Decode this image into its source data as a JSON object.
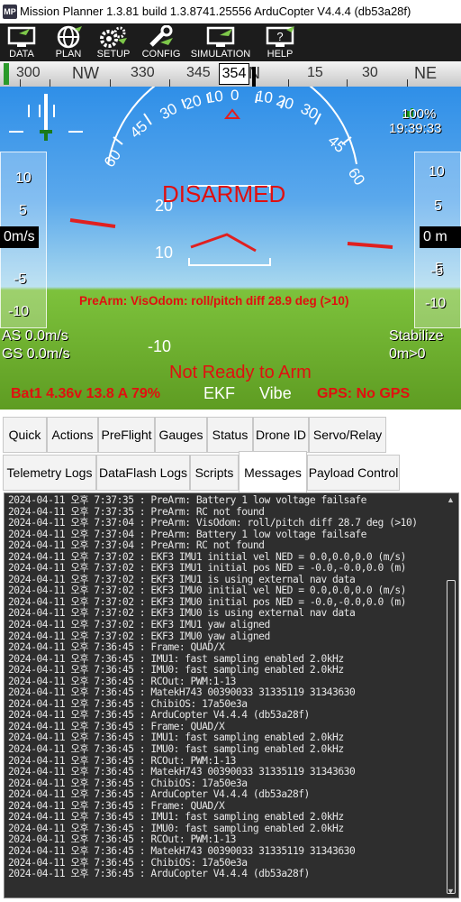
{
  "window": {
    "title": "Mission Planner 1.3.81 build 1.3.8741.25556 ArduCopter V4.4.4 (db53a28f)",
    "icon_text": "MP"
  },
  "toolbar": {
    "items": [
      {
        "label": "DATA",
        "icon": "monitor-plane-icon"
      },
      {
        "label": "PLAN",
        "icon": "globe-icon"
      },
      {
        "label": "SETUP",
        "icon": "gears-icon"
      },
      {
        "label": "CONFIG",
        "icon": "wrench-icon"
      },
      {
        "label": "SIMULATION",
        "icon": "monitor-icon"
      },
      {
        "label": "HELP",
        "icon": "help-monitor-icon"
      }
    ]
  },
  "compass": {
    "labels": [
      "300",
      "NW",
      "330",
      "345",
      "N",
      "15",
      "30",
      "NE"
    ],
    "heading": "354"
  },
  "hud": {
    "status": "DISARMED",
    "prearm_message": "PreArm: VisOdom: roll/pitch diff 28.9 deg (>10)",
    "airspeed": "AS 0.0m/s",
    "groundspeed": "GS 0.0m/s",
    "mode": "Stabilize",
    "wp_distance": "0m>0",
    "arm_status": "Not Ready to Arm",
    "battery": "Bat1 4.36v 13.8 A 79%",
    "ekf": "EKF",
    "vibe": "Vibe",
    "gps": "GPS: No GPS",
    "link_quality": "100%",
    "clock": "19:39:33",
    "speed_box": "0m/s",
    "alt_box": "0 m",
    "speed_ticks": [
      "10",
      "5",
      "-5",
      "-10"
    ],
    "alt_ticks": [
      "10",
      "5",
      "-5",
      "-10"
    ],
    "roll_labels": [
      "60",
      "45",
      "30",
      "20",
      "10",
      "0",
      "10",
      "20",
      "30",
      "45",
      "60"
    ],
    "pitch_labels": [
      "20",
      "10",
      "-10"
    ],
    "colors": {
      "sky_top": "#2f8fe8",
      "ground": "#5e9c22",
      "alert_red": "#e01010",
      "attitude_red": "#e02020"
    }
  },
  "tabs": {
    "row1": [
      "Quick",
      "Actions",
      "PreFlight",
      "Gauges",
      "Status",
      "Drone ID",
      "Servo/Relay"
    ],
    "row2": [
      "Telemetry Logs",
      "DataFlash Logs",
      "Scripts",
      "Messages",
      "Payload Control"
    ],
    "active": "Messages"
  },
  "messages": [
    "2024-04-11 오후 7:37:35 : PreArm: Battery 1 low voltage failsafe",
    "2024-04-11 오후 7:37:35 : PreArm: RC not found",
    "2024-04-11 오후 7:37:04 : PreArm: VisOdom: roll/pitch diff 28.7 deg (>10)",
    "2024-04-11 오후 7:37:04 : PreArm: Battery 1 low voltage failsafe",
    "2024-04-11 오후 7:37:04 : PreArm: RC not found",
    "2024-04-11 오후 7:37:02 : EKF3 IMU1 initial vel NED = 0.0,0.0,0.0 (m/s)",
    "2024-04-11 오후 7:37:02 : EKF3 IMU1 initial pos NED = -0.0,-0.0,0.0 (m)",
    "2024-04-11 오후 7:37:02 : EKF3 IMU1 is using external nav data",
    "2024-04-11 오후 7:37:02 : EKF3 IMU0 initial vel NED = 0.0,0.0,0.0 (m/s)",
    "2024-04-11 오후 7:37:02 : EKF3 IMU0 initial pos NED = -0.0,-0.0,0.0 (m)",
    "2024-04-11 오후 7:37:02 : EKF3 IMU0 is using external nav data",
    "2024-04-11 오후 7:37:02 : EKF3 IMU1 yaw aligned",
    "2024-04-11 오후 7:37:02 : EKF3 IMU0 yaw aligned",
    "2024-04-11 오후 7:36:45 : Frame: QUAD/X",
    "2024-04-11 오후 7:36:45 : IMU1: fast sampling enabled 2.0kHz",
    "2024-04-11 오후 7:36:45 : IMU0: fast sampling enabled 2.0kHz",
    "2024-04-11 오후 7:36:45 : RCOut: PWM:1-13",
    "2024-04-11 오후 7:36:45 : MatekH743 00390033 31335119 31343630",
    "2024-04-11 오후 7:36:45 : ChibiOS: 17a50e3a",
    "2024-04-11 오후 7:36:45 : ArduCopter V4.4.4 (db53a28f)",
    "2024-04-11 오후 7:36:45 : Frame: QUAD/X",
    "2024-04-11 오후 7:36:45 : IMU1: fast sampling enabled 2.0kHz",
    "2024-04-11 오후 7:36:45 : IMU0: fast sampling enabled 2.0kHz",
    "2024-04-11 오후 7:36:45 : RCOut: PWM:1-13",
    "2024-04-11 오후 7:36:45 : MatekH743 00390033 31335119 31343630",
    "2024-04-11 오후 7:36:45 : ChibiOS: 17a50e3a",
    "2024-04-11 오후 7:36:45 : ArduCopter V4.4.4 (db53a28f)",
    "2024-04-11 오후 7:36:45 : Frame: QUAD/X",
    "2024-04-11 오후 7:36:45 : IMU1: fast sampling enabled 2.0kHz",
    "2024-04-11 오후 7:36:45 : IMU0: fast sampling enabled 2.0kHz",
    "2024-04-11 오후 7:36:45 : RCOut: PWM:1-13",
    "2024-04-11 오후 7:36:45 : MatekH743 00390033 31335119 31343630",
    "2024-04-11 오후 7:36:45 : ChibiOS: 17a50e3a",
    "2024-04-11 오후 7:36:45 : ArduCopter V4.4.4 (db53a28f)"
  ]
}
